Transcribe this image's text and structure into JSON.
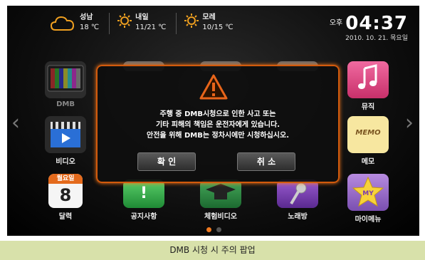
{
  "weather": {
    "today": {
      "city": "성남",
      "temp": "18 ℃",
      "icon": "cloud-icon"
    },
    "tomorrow": {
      "label": "내일",
      "temp": "11/21 ℃",
      "icon": "sun-icon"
    },
    "day_after": {
      "label": "모레",
      "temp": "10/15 ℃",
      "icon": "sun-icon"
    }
  },
  "clock": {
    "ampm": "오후",
    "time": "04:37",
    "date": "2010. 10. 21. 목요일"
  },
  "apps": {
    "dmb": "DMB",
    "music": "뮤직",
    "video": "비디오",
    "memo": "메모",
    "calendar": "달력",
    "calendar_day": "월요일",
    "calendar_num": "8",
    "memo_text": "MEMO",
    "notice": "공지사항",
    "exp_video": "체험비디오",
    "karaoke": "노래방",
    "mymenu": "마이메뉴",
    "mymenu_badge": "MY"
  },
  "modal": {
    "line1": "주행 중 DMB시청으로 인한 사고 또는",
    "line2": "기타 피해의 책임은 운전자에게 있습니다.",
    "line3": "안전을 위해 DMB는 정차시에만 시청하십시오.",
    "confirm": "확 인",
    "cancel": "취 소"
  },
  "pager": {
    "active": 0,
    "count": 2
  },
  "caption": "DMB 시청 시 주의 팝업",
  "colors": {
    "accent": "#d25a0c",
    "caption_bg": "#d8e1aa"
  }
}
